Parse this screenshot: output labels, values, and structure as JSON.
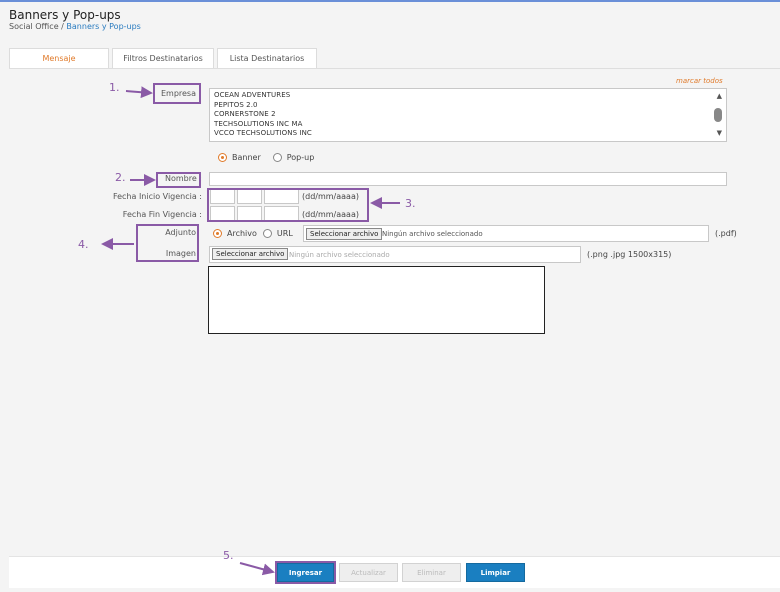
{
  "header": {
    "title": "Banners y Pop-ups",
    "breadcrumb_root": "Social Office",
    "breadcrumb_sep": " / ",
    "breadcrumb_current": "Banners y Pop-ups"
  },
  "tabs": [
    {
      "label": "Mensaje",
      "active": true
    },
    {
      "label": "Filtros Destinatarios",
      "active": false
    },
    {
      "label": "Lista Destinatarios",
      "active": false
    }
  ],
  "form": {
    "mark_all": "marcar todos",
    "empresa_label": "Empresa",
    "companies": [
      "OCEAN ADVENTURES",
      "PEPITOS 2.0",
      "CORNERSTONE 2",
      "TECHSOLUTIONS INC MA",
      "VCCO TECHSOLUTIONS INC"
    ],
    "type_options": [
      {
        "label": "Banner",
        "selected": true
      },
      {
        "label": "Pop-up",
        "selected": false
      }
    ],
    "nombre_label": "Nombre :",
    "nombre_value": "",
    "fecha_inicio_label": "Fecha Inicio Vigencia :",
    "fecha_fin_label": "Fecha Fin Vigencia :",
    "date_hint": "(dd/mm/aaaa)",
    "adjunto_label": "Adjunto",
    "adjunto_options": [
      {
        "label": "Archivo",
        "selected": true
      },
      {
        "label": "URL",
        "selected": false
      }
    ],
    "file_button": "Seleccionar archivo",
    "adjunto_file_status": "Ningún archivo seleccionado",
    "adjunto_hint": "(.pdf)",
    "imagen_label": "Imagen",
    "imagen_file_status": "Ningún archivo seleccionado",
    "imagen_hint": "(.png .jpg 1500x315)"
  },
  "footer": {
    "ingresar": "Ingresar",
    "actualizar": "Actualizar",
    "eliminar": "Eliminar",
    "limpiar": "Limpiar"
  },
  "annotations": {
    "n1": "1.",
    "n2": "2.",
    "n3": "3.",
    "n4": "4.",
    "n5": "5.",
    "color": "#8a5aa6"
  },
  "colors": {
    "accent_orange": "#e07a2a",
    "primary_blue": "#1a7fc1",
    "link_blue": "#2a7cc0"
  }
}
